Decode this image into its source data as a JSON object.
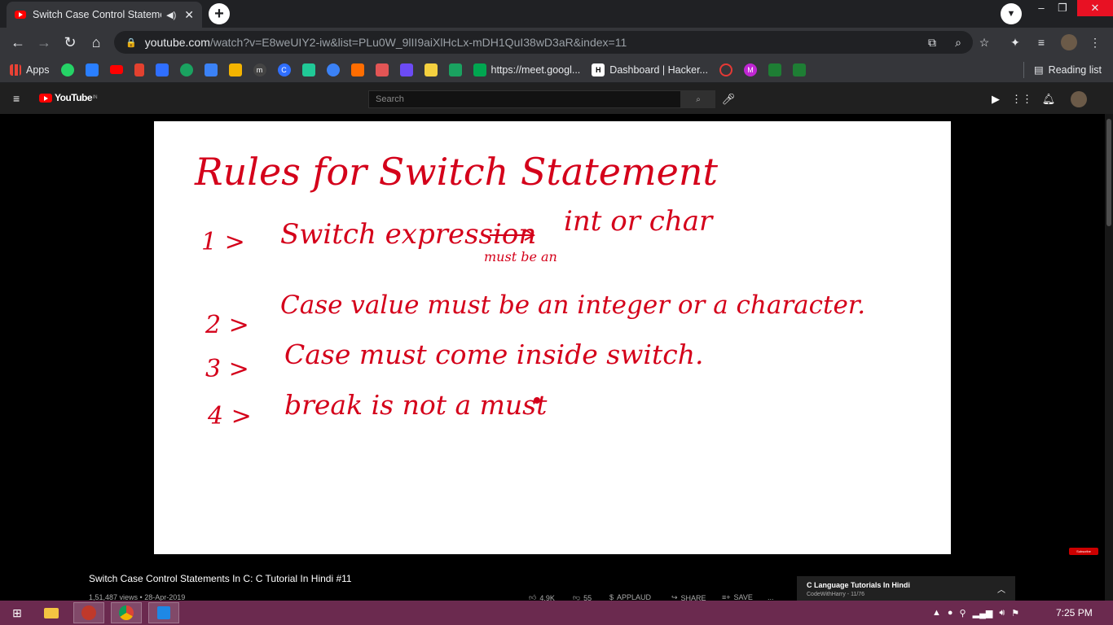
{
  "browser": {
    "tab_title": "Switch Case Control Statements In C: C Tutorial In Hindi #11",
    "new_tab_label": "+",
    "url_host": "youtube.com",
    "url_rest": "/watch?v=E8weUIY2-iw&list=PLu0W_9lII9aiXlHcLx-mDH1QuI38wD3aR&index=11",
    "minimize": "–",
    "restore": "❐",
    "close": "✕"
  },
  "bookmarks": {
    "apps_label": "Apps",
    "meet_label": "https://meet.googl...",
    "hacker_label": "Dashboard | Hacker...",
    "hacker_badge": "H",
    "m_badge": "M",
    "m_small": "m",
    "c_badge": "C",
    "reading_list": "Reading list",
    "icon_colors": [
      "#25d366",
      "#2a7fff",
      "#ff0000",
      "#e3412f",
      "#2f6fff",
      "#1aa260",
      "#3b82f6",
      "#f4b400",
      "#444",
      "#2f6fff",
      "#20c997",
      "#3b82f6",
      "#ff6d00",
      "#e25555",
      "#6c4bf5",
      "#f4d03f",
      "#1aa260",
      "#00a650"
    ]
  },
  "youtube": {
    "logo_text": "YouTube",
    "region": "IN",
    "search_placeholder": "Search"
  },
  "video": {
    "title": "Switch Case Control Statements In C: C Tutorial In Hindi #11",
    "meta": "1,51,487 views • 28-Apr-2019",
    "likes": "4.9K",
    "dislikes": "55",
    "applaud": "APPLAUD",
    "share": "SHARE",
    "save": "SAVE",
    "more": "...",
    "subscribe_watermark": "Subscribe",
    "whiteboard": {
      "heading": "Rules for Switch Statement",
      "rule1_num": "1 >",
      "rule1_text": "Switch expression",
      "rule1_arrow_note": "must be an",
      "rule1_result": "int or char",
      "rule2_num": "2 >",
      "rule2_text": "Case value must be an integer or a character.",
      "rule3_num": "3 >",
      "rule3_text": "Case must come inside switch.",
      "rule4_num": "4 >",
      "rule4_text": "break is not a must"
    },
    "ink_color": "#d4001a"
  },
  "playlist": {
    "title": "C Language Tutorials In Hindi",
    "subtitle": "CodeWithHarry - 11/76"
  },
  "taskbar": {
    "time": "7:25 PM",
    "color": "#6b2a4f"
  }
}
